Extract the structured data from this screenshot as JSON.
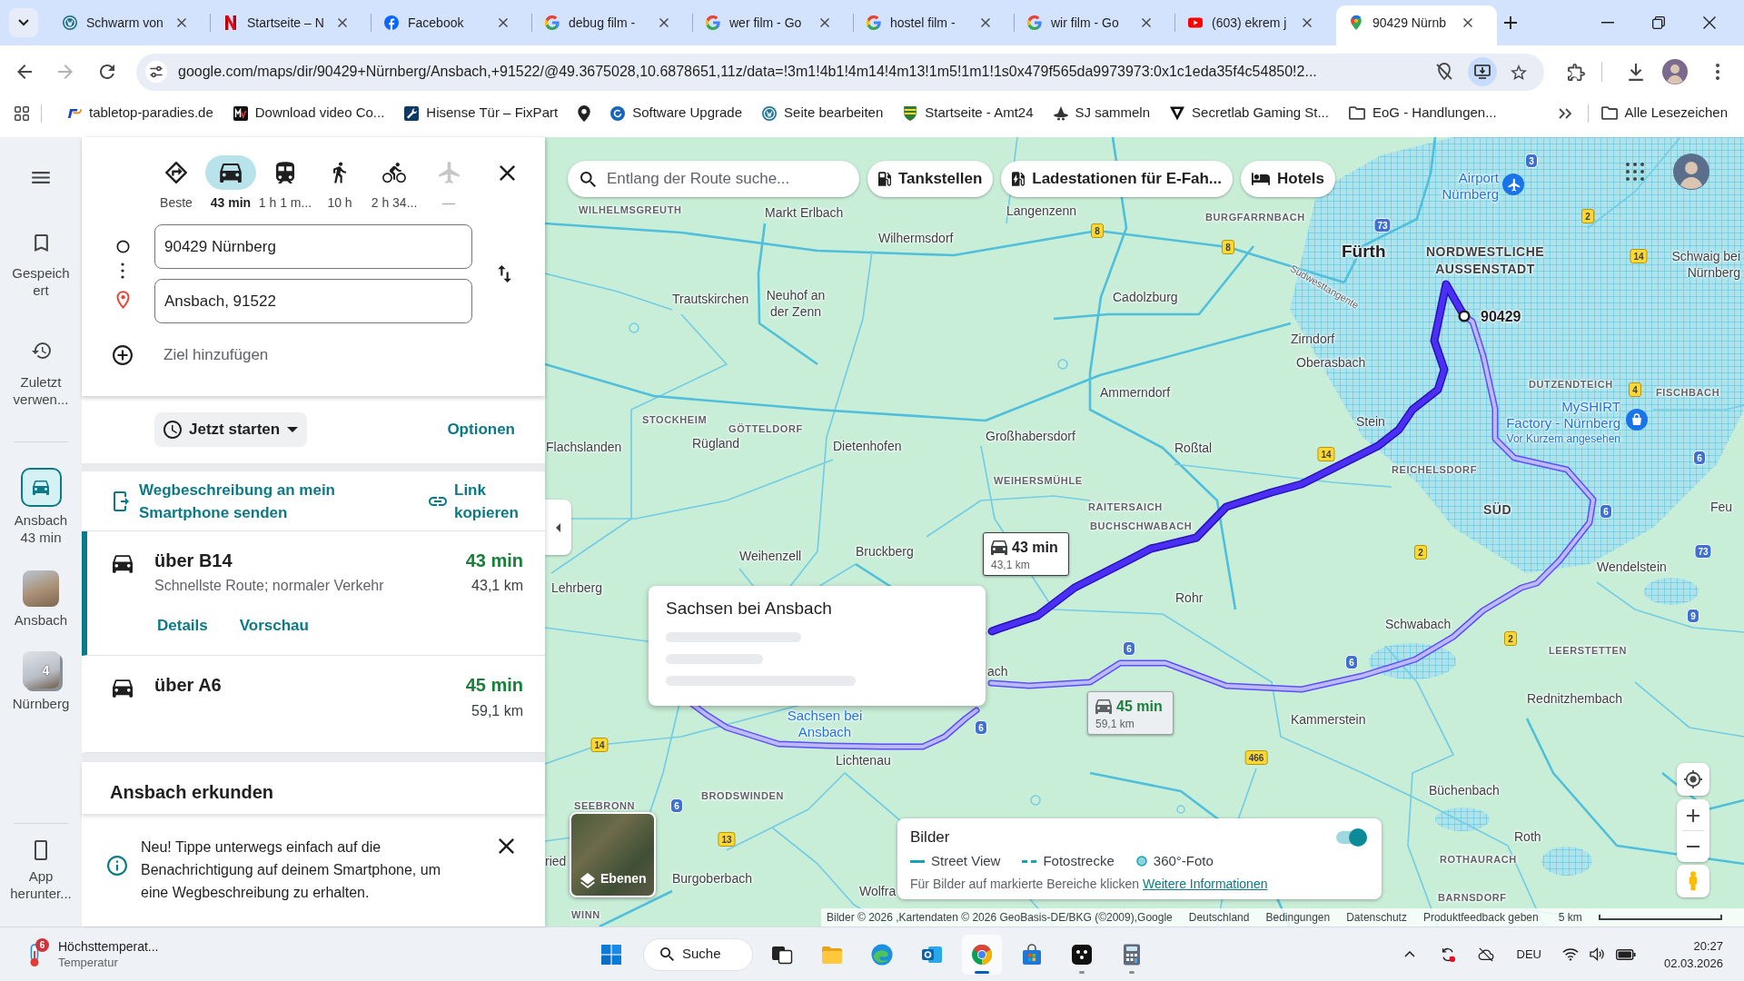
{
  "tab_strip": {
    "tabs": [
      {
        "title": "Schwarm von",
        "kind": "ring",
        "selected": false
      },
      {
        "title": "Startseite – N",
        "kind": "ribbon",
        "selected": false
      },
      {
        "title": "Facebook",
        "kind": "disc",
        "selected": false
      },
      {
        "title": "debug film -",
        "kind": "g",
        "selected": false
      },
      {
        "title": "wer film - Go",
        "kind": "g",
        "selected": false
      },
      {
        "title": "hostel film -",
        "kind": "g",
        "selected": false
      },
      {
        "title": "wir film - Go",
        "kind": "g",
        "selected": false
      },
      {
        "title": "(603) ekrem j",
        "kind": "play",
        "selected": false
      },
      {
        "title": "90429 Nürnb",
        "kind": "pin",
        "selected": true
      }
    ]
  },
  "toolbar": {
    "forward": {
      "disabled": true
    },
    "url": "google.com/maps/dir/90429+Nürnberg/Ansbach,+91522/@49.3675028,10.6878651,11z/data=!3m1!4b1!4m14!4m13!1m5!1m1!1s0x479f565da9973973:0x1c1eda35f4c54850!2..."
  },
  "bookmarks": [
    {
      "label": "tabletop-paradies.de",
      "kind": "p"
    },
    {
      "label": "Download video Co...",
      "kind": "mv"
    },
    {
      "label": "Hisense Tür – FixPart",
      "kind": "wrench"
    },
    {
      "kind": "locator"
    },
    {
      "label": "Software Upgrade",
      "kind": "swirl"
    },
    {
      "label": "Seite bearbeiten",
      "kind": "ring"
    },
    {
      "label": "Startseite - Amt24",
      "kind": "crest"
    },
    {
      "label": "SJ sammeln",
      "kind": "hat"
    },
    {
      "label": "Secretlab Gaming St...",
      "kind": "triangle"
    },
    {
      "label": "EoG - Handlungen...",
      "kind": "folder"
    }
  ],
  "all_bookmarks": "Alle Lesezeichen",
  "rail": {
    "items": [
      {
        "label": "Gespeichert",
        "kind": "saved",
        "selected": false
      },
      {
        "label": "Zuletzt verwen...",
        "kind": "recent",
        "selected": false
      },
      {
        "label": "Ansbach",
        "sublabel": "43 min",
        "kind": "trip",
        "selected": true
      },
      {
        "label": "Ansbach",
        "kind": "place",
        "selected": false
      },
      {
        "label": "Nürnberg",
        "kind": "stack",
        "badge": "4",
        "selected": false
      },
      {
        "label": "App herunter...",
        "kind": "app",
        "selected": false
      }
    ]
  },
  "directions": {
    "modes": [
      {
        "label": "Beste",
        "kind": "best",
        "selected": false,
        "disabled": false
      },
      {
        "label": "43 min",
        "kind": "car",
        "selected": true,
        "disabled": false
      },
      {
        "label": "1 h 1 m...",
        "kind": "transit",
        "selected": false,
        "disabled": false
      },
      {
        "label": "10 h",
        "kind": "walk",
        "selected": false,
        "disabled": false
      },
      {
        "label": "2 h 34...",
        "kind": "bike",
        "selected": false,
        "disabled": false
      },
      {
        "label": "—",
        "kind": "flight",
        "selected": false,
        "disabled": true
      }
    ],
    "origin": "90429 Nürnberg",
    "destination": "Ansbach, 91522",
    "add_stop": "Ziel hinzufügen",
    "depart": "Jetzt starten",
    "options": "Optionen",
    "send_to_phone": "Wegbeschreibung an mein Smartphone senden",
    "copy_link": "Link kopieren",
    "routes": [
      {
        "title": "über B14",
        "duration": "43 min",
        "note": "Schnellste Route; normaler Verkehr",
        "distance": "43,1 km",
        "links": [
          "Details",
          "Vorschau"
        ],
        "selected": true
      },
      {
        "title": "über A6",
        "duration": "45 min",
        "distance": "59,1 km",
        "selected": false
      }
    ],
    "explore": "Ansbach erkunden",
    "notice": "Neu! Tippe unterwegs einfach auf die Benachrichtigung auf deinem Smartphone, um eine Wegbeschreibung zu erhalten."
  },
  "map": {
    "search": {
      "placeholder": "Entlang der Route suche..."
    },
    "chips": [
      {
        "label": "Tankstellen",
        "kind": "fuel"
      },
      {
        "label": "Ladestationen für E-Fah...",
        "kind": "charging"
      },
      {
        "label": "Hotels",
        "kind": "hotel"
      }
    ],
    "labels": [
      {
        "lines": [
          "Airport",
          "Nürnberg"
        ],
        "kind": "poi"
      },
      {
        "lines": [
          "WILHELMSGREUTH"
        ],
        "kind": "district"
      },
      {
        "lines": [
          "Markt Erlbach"
        ],
        "kind": "town"
      },
      {
        "lines": [
          "Langenzenn"
        ],
        "kind": "town"
      },
      {
        "lines": [
          "BURGFARRNBACH"
        ],
        "kind": "district"
      },
      {
        "lines": [
          "Wilhermsdorf"
        ],
        "kind": "town"
      },
      {
        "lines": [
          "Fürth"
        ],
        "kind": "city"
      },
      {
        "lines": [
          "Trautskirchen"
        ],
        "kind": "town"
      },
      {
        "lines": [
          "Neuhof an",
          "der Zenn"
        ],
        "kind": "town"
      },
      {
        "lines": [
          "Cadolzburg"
        ],
        "kind": "town"
      },
      {
        "lines": [
          "Südwesttangente"
        ],
        "kind": "road"
      },
      {
        "lines": [
          "NORDWESTLICHE",
          "AUSSENSTADT"
        ],
        "kind": "borough"
      },
      {
        "lines": [
          "Schwaig bei",
          "Nürnberg"
        ],
        "kind": "town"
      },
      {
        "lines": [
          "90429"
        ],
        "kind": "marker"
      },
      {
        "lines": [
          "Zirndorf"
        ],
        "kind": "town"
      },
      {
        "lines": [
          "Oberasbach"
        ],
        "kind": "town"
      },
      {
        "lines": [
          "Ammerndorf"
        ],
        "kind": "town"
      },
      {
        "lines": [
          "DUTZENDTEICH"
        ],
        "kind": "district"
      },
      {
        "lines": [
          "FISCHBACH"
        ],
        "kind": "district"
      },
      {
        "lines": [
          "Flachslanden"
        ],
        "kind": "town"
      },
      {
        "lines": [
          "STOCKHEIM"
        ],
        "kind": "district"
      },
      {
        "lines": [
          "Rügland"
        ],
        "kind": "town"
      },
      {
        "lines": [
          "GÖTTELDORF"
        ],
        "kind": "district"
      },
      {
        "lines": [
          "Dietenhofen"
        ],
        "kind": "town"
      },
      {
        "lines": [
          "Großhabersdorf"
        ],
        "kind": "town"
      },
      {
        "lines": [
          "Roßtal"
        ],
        "kind": "town"
      },
      {
        "lines": [
          "Stein"
        ],
        "kind": "town"
      },
      {
        "lines": [
          "MySHIRT",
          "Factory - Nürnberg"
        ],
        "kind": "poi"
      },
      {
        "lines": [
          "Vor Kurzem angesehen"
        ],
        "kind": "poi_note"
      },
      {
        "lines": [
          "WEIHERSMÜHLE"
        ],
        "kind": "district"
      },
      {
        "lines": [
          "REICHELSDORF"
        ],
        "kind": "district"
      },
      {
        "lines": [
          "RAITERSAICH"
        ],
        "kind": "district"
      },
      {
        "lines": [
          "SÜD"
        ],
        "kind": "borough"
      },
      {
        "lines": [
          "Feu"
        ],
        "kind": "town"
      },
      {
        "lines": [
          "BUCHSCHWABACH"
        ],
        "kind": "district"
      },
      {
        "lines": [
          "Weihenzell"
        ],
        "kind": "town"
      },
      {
        "lines": [
          "Bruckberg"
        ],
        "kind": "town"
      },
      {
        "lines": [
          "Wendelstein"
        ],
        "kind": "town"
      },
      {
        "lines": [
          "Lehrberg"
        ],
        "kind": "town"
      },
      {
        "lines": [
          "Rohr"
        ],
        "kind": "town"
      },
      {
        "lines": [
          "Schwabach"
        ],
        "kind": "town"
      },
      {
        "lines": [
          "LEERSTETTEN"
        ],
        "kind": "district"
      },
      {
        "lines": [
          "ach"
        ],
        "kind": "town"
      },
      {
        "lines": [
          "Rednitzhembach"
        ],
        "kind": "town"
      },
      {
        "lines": [
          "Sachsen bei",
          "Ansbach"
        ],
        "kind": "poi"
      },
      {
        "lines": [
          "Kammerstein"
        ],
        "kind": "town"
      },
      {
        "lines": [
          "Lichtenau"
        ],
        "kind": "town"
      },
      {
        "lines": [
          "SEEBRONN"
        ],
        "kind": "district"
      },
      {
        "lines": [
          "BRODSWINDEN"
        ],
        "kind": "district"
      },
      {
        "lines": [
          "Büchenbach"
        ],
        "kind": "town"
      },
      {
        "lines": [
          "Roth"
        ],
        "kind": "town"
      },
      {
        "lines": [
          "ried"
        ],
        "kind": "town"
      },
      {
        "lines": [
          "Burgoberbach"
        ],
        "kind": "town"
      },
      {
        "lines": [
          "ROTHAURACH"
        ],
        "kind": "district"
      },
      {
        "lines": [
          "Wolfra"
        ],
        "kind": "town"
      },
      {
        "lines": [
          "BARNSDORF"
        ],
        "kind": "district"
      },
      {
        "lines": [
          "WINN"
        ],
        "kind": "district"
      }
    ],
    "shields": [
      {
        "text": "8",
        "kind": "federal"
      },
      {
        "text": "8",
        "kind": "federal"
      },
      {
        "text": "73",
        "kind": "autobahn"
      },
      {
        "text": "3",
        "kind": "autobahn"
      },
      {
        "text": "2",
        "kind": "federal"
      },
      {
        "text": "14",
        "kind": "federal"
      },
      {
        "text": "4",
        "kind": "federal"
      },
      {
        "text": "6",
        "kind": "autobahn"
      },
      {
        "text": "14",
        "kind": "federal"
      },
      {
        "text": "6",
        "kind": "autobahn"
      },
      {
        "text": "2",
        "kind": "federal"
      },
      {
        "text": "73",
        "kind": "autobahn"
      },
      {
        "text": "9",
        "kind": "autobahn"
      },
      {
        "text": "2",
        "kind": "federal"
      },
      {
        "text": "6",
        "kind": "autobahn"
      },
      {
        "text": "6",
        "kind": "autobahn"
      },
      {
        "text": "6",
        "kind": "autobahn"
      },
      {
        "text": "14",
        "kind": "federal"
      },
      {
        "text": "466",
        "kind": "federal"
      },
      {
        "text": "6",
        "kind": "autobahn"
      },
      {
        "text": "13",
        "kind": "federal"
      }
    ],
    "route_callouts": [
      {
        "duration": "43 min",
        "distance": "43,1 km",
        "selected": true
      },
      {
        "duration": "45 min",
        "distance": "59,1 km",
        "selected": false
      }
    ],
    "place_card": {
      "title": "Sachsen bei Ansbach",
      "loading": true
    },
    "layers": "Ebenen",
    "imagery": {
      "title": "Bilder",
      "on": true,
      "legend": [
        {
          "label": "Street View",
          "kind": "line"
        },
        {
          "label": "Fotostrecke",
          "kind": "dashed"
        },
        {
          "label": "360°-Foto",
          "kind": "dot"
        }
      ],
      "hint": "Für Bilder auf markierte Bereiche klicken",
      "link": "Weitere Informationen"
    },
    "attribution": [
      "Bilder © 2026 ,Kartendaten © 2026 GeoBasis-DE/BKG (©2009),Google",
      "Deutschland",
      "Bedingungen",
      "Datenschutz",
      "Produktfeedback geben"
    ],
    "scale": "5 km"
  },
  "taskbar": {
    "weather": {
      "badge": "6",
      "title": "Höchsttemperat...",
      "subtitle": "Temperatur"
    },
    "search": "Suche",
    "apps": [
      {
        "kind": "taskview",
        "running": false,
        "selected": false
      },
      {
        "kind": "folder",
        "running": false,
        "selected": false
      },
      {
        "kind": "swirl",
        "running": false,
        "selected": false
      },
      {
        "kind": "mail",
        "running": false,
        "selected": false
      },
      {
        "kind": "browser",
        "running": true,
        "selected": true
      },
      {
        "kind": "bag",
        "running": false,
        "selected": false
      },
      {
        "kind": "dots",
        "running": true,
        "selected": false
      },
      {
        "kind": "calculator",
        "running": true,
        "selected": false
      }
    ],
    "tray": {
      "language": "DEU",
      "time": "20:27",
      "date": "02.03.2026"
    }
  }
}
